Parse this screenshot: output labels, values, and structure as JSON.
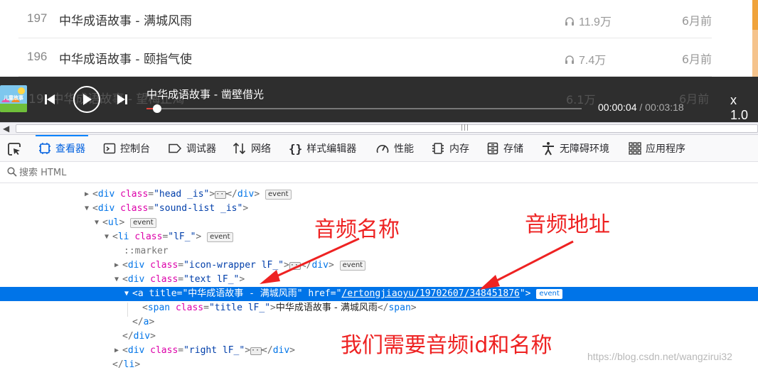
{
  "web_list": {
    "rows": [
      {
        "num": "197",
        "title": "中华成语故事 - 满城风雨",
        "plays": "11.9万",
        "time": "6月前"
      },
      {
        "num": "196",
        "title": "中华成语故事 - 颐指气使",
        "plays": "7.4万",
        "time": "6月前"
      }
    ],
    "obscured_row": {
      "num": "19",
      "title": "中华成语故事 - 望梅止渴",
      "plays": "6.1万",
      "time": "6月前"
    }
  },
  "player": {
    "now_playing": "中华成语故事 - 凿壁借光",
    "cover_text": "儿童故事",
    "current_time": "00:00:04",
    "separator": " / ",
    "duration": "00:03:18",
    "progress_fraction": 0.025,
    "speed": "x 1.0"
  },
  "devtools": {
    "tabs": [
      {
        "label": "查看器",
        "icon": "inspector-icon",
        "selected": true
      },
      {
        "label": "控制台",
        "icon": "console-icon"
      },
      {
        "label": "调试器",
        "icon": "debugger-icon"
      },
      {
        "label": "网络",
        "icon": "network-icon"
      },
      {
        "label": "样式编辑器",
        "icon": "style-editor-icon"
      },
      {
        "label": "性能",
        "icon": "performance-icon"
      },
      {
        "label": "内存",
        "icon": "memory-icon"
      },
      {
        "label": "存储",
        "icon": "storage-icon"
      },
      {
        "label": "无障碍环境",
        "icon": "accessibility-icon"
      },
      {
        "label": "应用程序",
        "icon": "application-icon"
      }
    ],
    "search_placeholder": "搜索 HTML",
    "event_badge": "event",
    "tree": {
      "head_class": "\"head _is\"",
      "sound_list_class": "\"sound-list _is\"",
      "li_class": "\"lF_\"",
      "marker": "::marker",
      "icon_wrapper_class": "\"icon-wrapper lF_\"",
      "text_class": "\"text lF_\"",
      "a_title": "\"中华成语故事 - 满城风雨\"",
      "a_href": "/ertongjiaoyu/19702607/348451876",
      "span_class": "\"title lF_\"",
      "span_text": "中华成语故事 - 满城风雨",
      "right_class": "\"right lF_\""
    }
  },
  "annotations": {
    "audio_name": "音频名称",
    "audio_url": "音频地址",
    "need": "我们需要音频id和名称",
    "color": "#ee2222"
  },
  "watermark": "https://blog.csdn.net/wangzirui32",
  "colors": {
    "accent": "#0a84ff",
    "selected_row": "#0074e8",
    "progress": "#e6433a"
  }
}
